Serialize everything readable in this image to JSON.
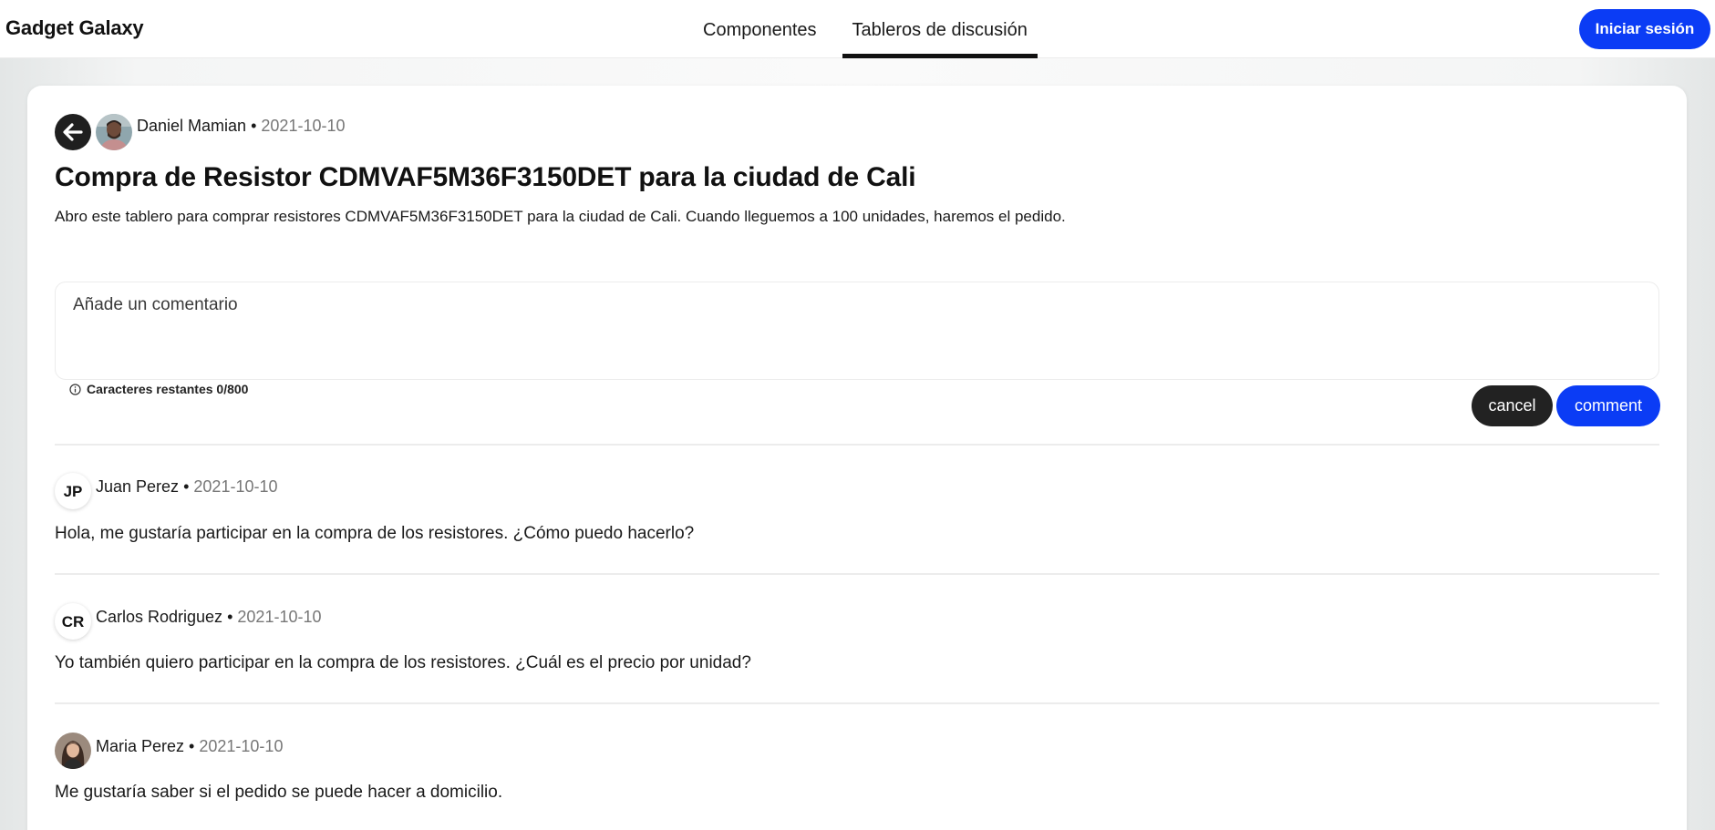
{
  "header": {
    "brand": "Gadget Galaxy",
    "tabs": [
      {
        "label": "Componentes",
        "active": false
      },
      {
        "label": "Tableros de discusión",
        "active": true
      }
    ],
    "login_label": "Iniciar sesión"
  },
  "post": {
    "author": "Daniel Mamian",
    "separator": "•",
    "date": "2021-10-10",
    "title": "Compra de Resistor CDMVAF5M36F3150DET para la ciudad de Cali",
    "body": "Abro este tablero para comprar resistores CDMVAF5M36F3150DET para la ciudad de Cali. Cuando lleguemos a 100 unidades, haremos el pedido."
  },
  "comment_form": {
    "placeholder": "Añade un comentario",
    "char_counter": "Caracteres restantes 0/800",
    "cancel_label": "cancel",
    "submit_label": "comment"
  },
  "comments": [
    {
      "initials": "JP",
      "author": "Juan Perez",
      "date": "2021-10-10",
      "text": "Hola, me gustaría participar en la compra de los resistores. ¿Cómo puedo hacerlo?"
    },
    {
      "initials": "CR",
      "author": "Carlos Rodriguez",
      "date": "2021-10-10",
      "text": "Yo también quiero participar en la compra de los resistores. ¿Cuál es el precio por unidad?"
    },
    {
      "initials": "",
      "author": "Maria Perez",
      "date": "2021-10-10",
      "text": "Me gustaría saber si el pedido se puede hacer a domicilio."
    }
  ],
  "colors": {
    "accent": "#0b3cf5",
    "dark": "#222222",
    "muted": "#777777"
  }
}
